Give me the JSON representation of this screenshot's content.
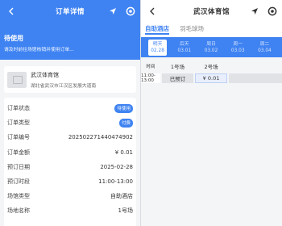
{
  "left": {
    "title": "订单详情",
    "status": {
      "title": "待使用",
      "hint": "请及时前往场馆核销并使用订单..."
    },
    "venue": {
      "name": "武汉体育馆",
      "address": "湖北省武汉市江汉区发展大道南"
    },
    "rows": [
      {
        "label": "订单状态",
        "value": "待使用",
        "badge": true
      },
      {
        "label": "订单类型",
        "value": "付费",
        "badge": true
      },
      {
        "label": "订单编号",
        "value": "2025022714404749​02"
      },
      {
        "label": "订单金额",
        "value": "¥ 0.01"
      },
      {
        "label": "预订日期",
        "value": "2025-02-28"
      },
      {
        "label": "预订时段",
        "value": "11:00-13:00"
      },
      {
        "label": "场馆类型",
        "value": "自助酒店"
      },
      {
        "label": "场地名称",
        "value": "1号场"
      }
    ]
  },
  "right": {
    "title": "武汉体育馆",
    "tabs": [
      "自助酒店",
      "羽毛球场"
    ],
    "dates": [
      {
        "day": "明天",
        "date": "02.28"
      },
      {
        "day": "后天",
        "date": "03.01"
      },
      {
        "day": "周日",
        "date": "03.02"
      },
      {
        "day": "周一",
        "date": "03.03"
      },
      {
        "day": "周二",
        "date": "03.04"
      }
    ],
    "grid": {
      "headers": [
        "时间",
        "1号场",
        "2号场",
        ""
      ],
      "rows": [
        {
          "time": "11:00-13:00",
          "cells": [
            "已预订",
            "¥ 0.01",
            ""
          ]
        }
      ]
    }
  },
  "icons": {
    "back": "chevron-left-icon",
    "locate": "location-arrow-icon",
    "target": "target-icon"
  },
  "colors": {
    "primary": "#3f83f2"
  }
}
